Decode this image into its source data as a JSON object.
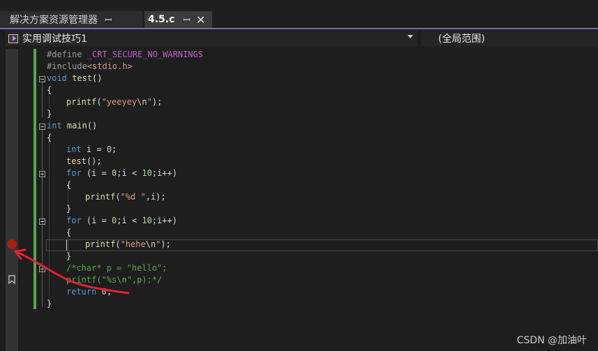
{
  "tabs": [
    {
      "label": "解决方案资源管理器",
      "pin": "ꟷ"
    },
    {
      "label": "4.5.c",
      "pin": "ꟷ",
      "close": "✕"
    }
  ],
  "nav": {
    "project": "实用调试技巧1",
    "scope": "(全局范围)"
  },
  "code": {
    "l1": {
      "pp": "#define ",
      "macro": "_CRT_SECURE_NO_WARNINGS"
    },
    "l2": {
      "pp": "#include",
      "str": "<stdio.h>"
    },
    "l3": {
      "kw": "void",
      "fn": "test",
      "pl": "()"
    },
    "l4": "{",
    "l6": {
      "fn": "printf",
      "pl1": "(",
      "str": "\"yeeyey",
      "esc": "\\n",
      "str2": "\"",
      "pl2": ");"
    },
    "l7": "}",
    "l8": {
      "kw": "int",
      "fn": "main",
      "pl": "()"
    },
    "l9": "{",
    "l10": {
      "kw": "int",
      "pl1": " i = ",
      "num": "0",
      "pl2": ";"
    },
    "l11": {
      "fn": "test",
      "pl": "();"
    },
    "l12": {
      "kw": "for",
      "pl1": " (i = ",
      "num1": "0",
      "pl2": ";i < ",
      "num2": "10",
      "pl3": ";i++)"
    },
    "l13": "{",
    "l14": {
      "fn": "printf",
      "pl1": "(",
      "str": "\"%d \"",
      "pl2": ",i);"
    },
    "l15": "}",
    "l16": {
      "kw": "for",
      "pl1": " (i = ",
      "num1": "0",
      "pl2": ";i < ",
      "num2": "10",
      "pl3": ";i++)"
    },
    "l17": "{",
    "l18": {
      "fn": "printf",
      "pl1": "(",
      "str": "\"hehe",
      "esc": "\\n",
      "str2": "\"",
      "pl2": ");"
    },
    "l19": "}",
    "l20": "/*char* p = \"hello\";",
    "l21": "printf(\"%s\\n\",p);*/",
    "l22": {
      "kw": "return",
      "pl1": " ",
      "num": "0",
      "pl2": ";"
    },
    "l23": "}"
  },
  "watermark": "CSDN @加油叶",
  "colors": {
    "accent": "#7b68b8",
    "breakpoint": "#e51400",
    "annotation": "#e0242c",
    "change_bar": "#57a64a"
  },
  "icons": [
    "pin-icon",
    "close-icon",
    "project-icon",
    "chevron-down-icon",
    "breakpoint-icon",
    "bookmark-icon"
  ]
}
